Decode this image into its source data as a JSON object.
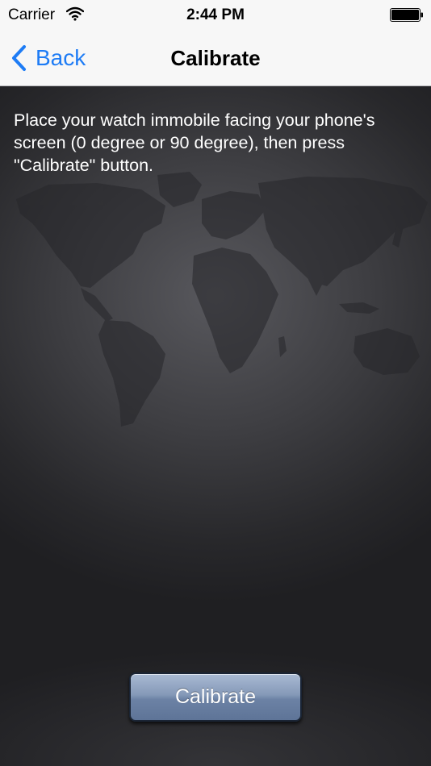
{
  "status_bar": {
    "carrier": "Carrier",
    "time": "2:44 PM",
    "icons": [
      "wifi-icon",
      "battery-icon"
    ]
  },
  "nav_bar": {
    "back_label": "Back",
    "back_icon": "chevron-left-icon",
    "title": "Calibrate",
    "accent_color": "#1e7cf5"
  },
  "main": {
    "instructions": "Place your watch immobile facing your phone's screen (0 degree or 90 degree), then press \"Calibrate\" button.",
    "background_icon": "world-map-icon",
    "calibrate_button_label": "Calibrate"
  }
}
